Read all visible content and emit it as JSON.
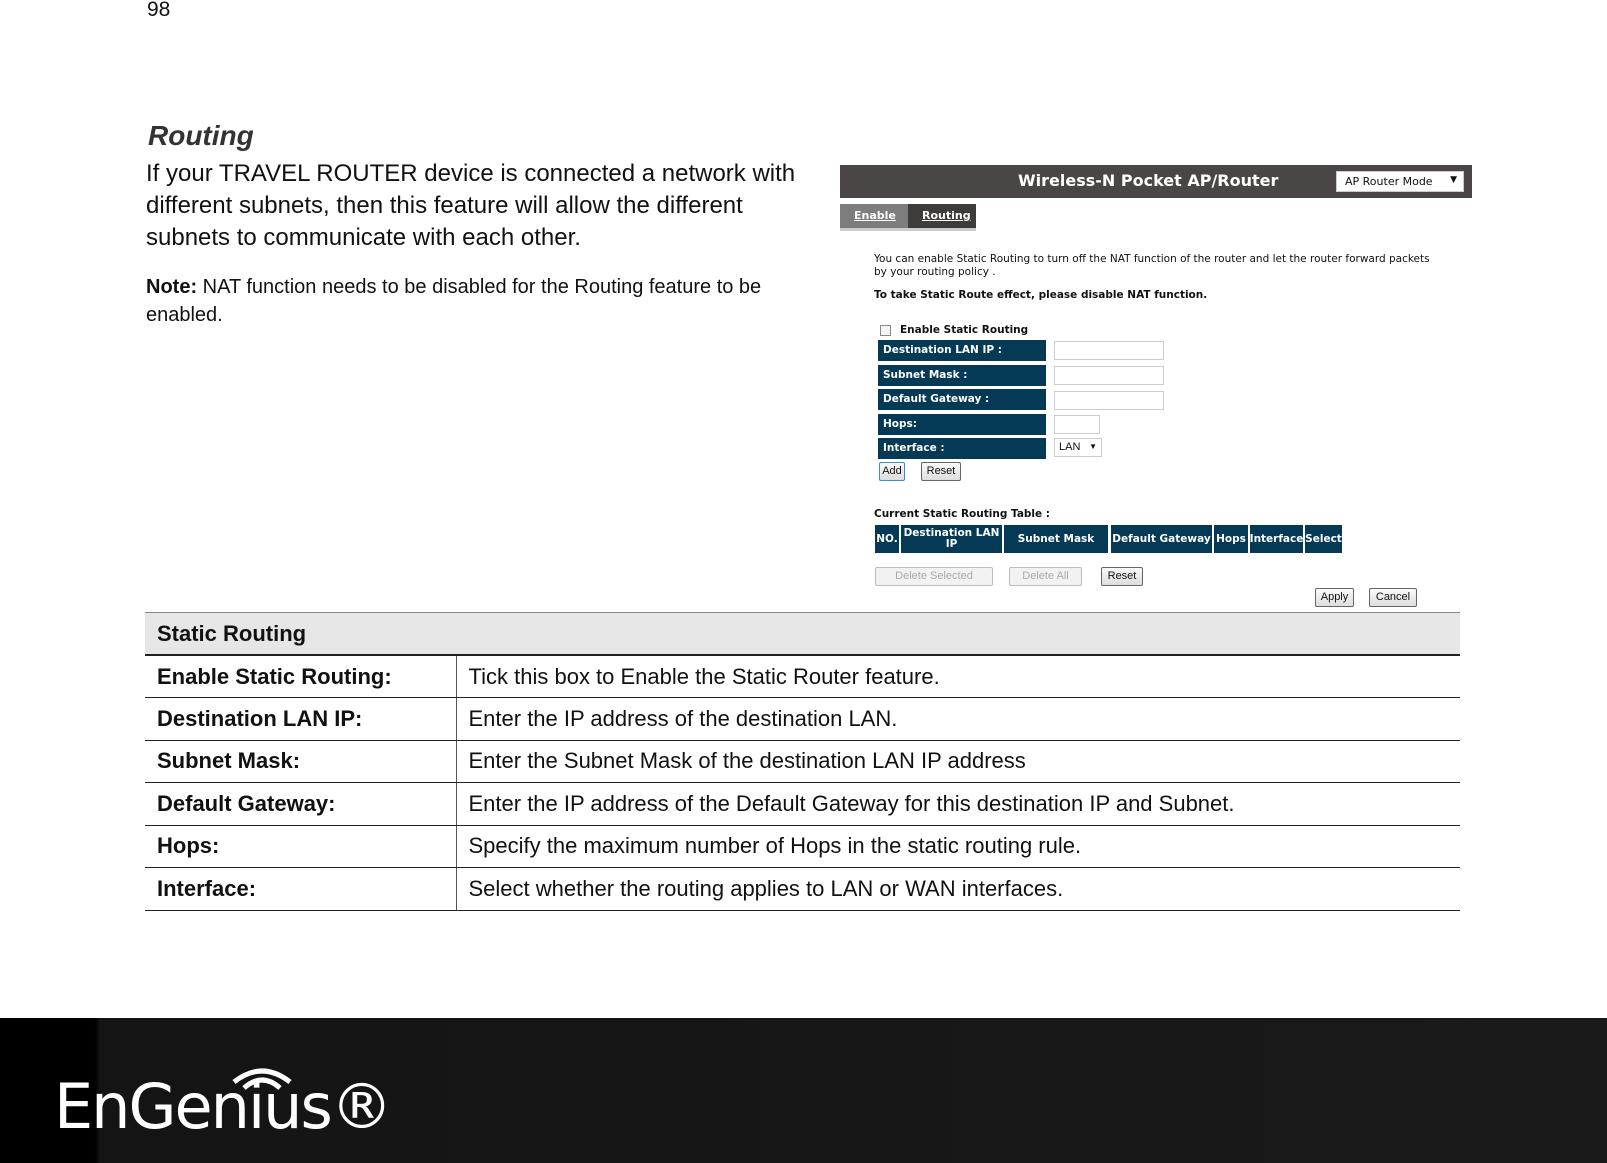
{
  "page_number": "98",
  "title": "Routing",
  "intro": "If your TRAVEL ROUTER device is connected a network with different subnets, then this feature will allow the different subnets to communicate with each other.",
  "note": {
    "label": "Note:",
    "text": " NAT function needs to be disabled for the Routing feature to be enabled."
  },
  "screenshot": {
    "header_title": "Wireless-N Pocket AP/Router",
    "mode_select": "AP Router Mode",
    "tabs": [
      "Enable",
      "Routing"
    ],
    "description": "You can enable Static Routing to turn off the NAT function of the router and let the router forward packets by your routing policy .",
    "warning": "To take Static Route effect, please disable NAT function.",
    "enable_checkbox_label": "Enable Static Routing",
    "enable_checked": false,
    "fields": [
      "Destination LAN IP :",
      "Subnet Mask :",
      "Default Gateway :",
      "Hops:",
      "Interface :"
    ],
    "interface_value": "LAN",
    "add": "Add",
    "reset": "Reset",
    "table_title": "Current Static Routing Table :",
    "columns": [
      "NO.",
      "Destination LAN IP",
      "Subnet Mask",
      "Default Gateway",
      "Hops",
      "Interface",
      "Select"
    ],
    "delete_selected": "Delete Selected",
    "delete_all": "Delete All",
    "reset2": "Reset",
    "apply": "Apply",
    "cancel": "Cancel"
  },
  "table": {
    "header": "Static Routing",
    "rows": [
      {
        "k": "Enable Static Routing:",
        "v": "Tick this box to Enable the Static Router feature."
      },
      {
        "k": "Destination LAN IP:",
        "v": "Enter the IP address of the destination LAN."
      },
      {
        "k": "Subnet Mask:",
        "v": "Enter the Subnet Mask of the destination LAN IP address"
      },
      {
        "k": "Default Gateway:",
        "v": "Enter the IP address of the Default Gateway for this destination IP and Subnet."
      },
      {
        "k": "Hops:",
        "v": "Specify the maximum number of Hops in the static routing rule."
      },
      {
        "k": "Interface:",
        "v": "Select whether the routing applies to LAN or WAN interfaces."
      }
    ]
  },
  "footer": {
    "logo": "EnGenius®"
  }
}
